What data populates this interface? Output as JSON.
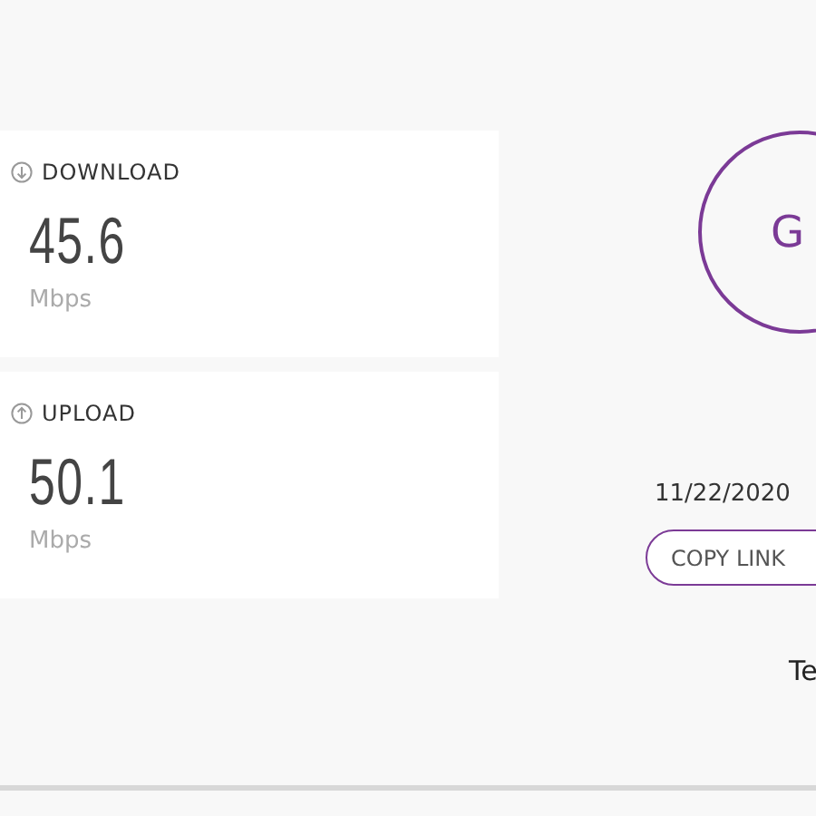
{
  "metrics": [
    {
      "kind": "download",
      "label": "DOWNLOAD",
      "value": "45.6",
      "unit": "Mbps"
    },
    {
      "kind": "upload",
      "label": "UPLOAD",
      "value": "50.1",
      "unit": "Mbps"
    }
  ],
  "go_button": {
    "label": "G"
  },
  "result": {
    "date": "11/22/2020",
    "copy_button": "COPY LINK",
    "footer_text": "Te"
  }
}
